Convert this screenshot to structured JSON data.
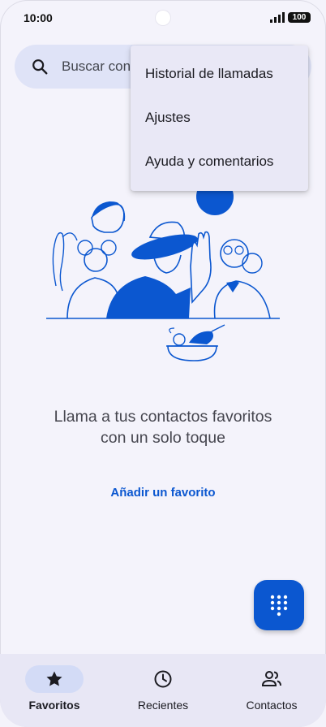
{
  "status_bar": {
    "time": "10:00",
    "battery": "100"
  },
  "search": {
    "placeholder": "Buscar con"
  },
  "menu": {
    "items": [
      {
        "label": "Historial de llamadas"
      },
      {
        "label": "Ajustes"
      },
      {
        "label": "Ayuda y comentarios"
      }
    ]
  },
  "empty_state": {
    "title": "Llama a tus contactos favoritos con un solo toque",
    "action": "Añadir un favorito"
  },
  "bottom_nav": {
    "items": [
      {
        "label": "Favoritos",
        "icon": "star-icon",
        "active": true
      },
      {
        "label": "Recientes",
        "icon": "clock-icon",
        "active": false
      },
      {
        "label": "Contactos",
        "icon": "people-icon",
        "active": false
      }
    ]
  },
  "colors": {
    "accent": "#0b57d0",
    "background": "#f4f3fb",
    "search_bg": "#dfe3f7",
    "menu_bg": "#e9e8f6",
    "nav_bg": "#e8e7f5",
    "nav_active_pill": "#d3dbf6"
  }
}
